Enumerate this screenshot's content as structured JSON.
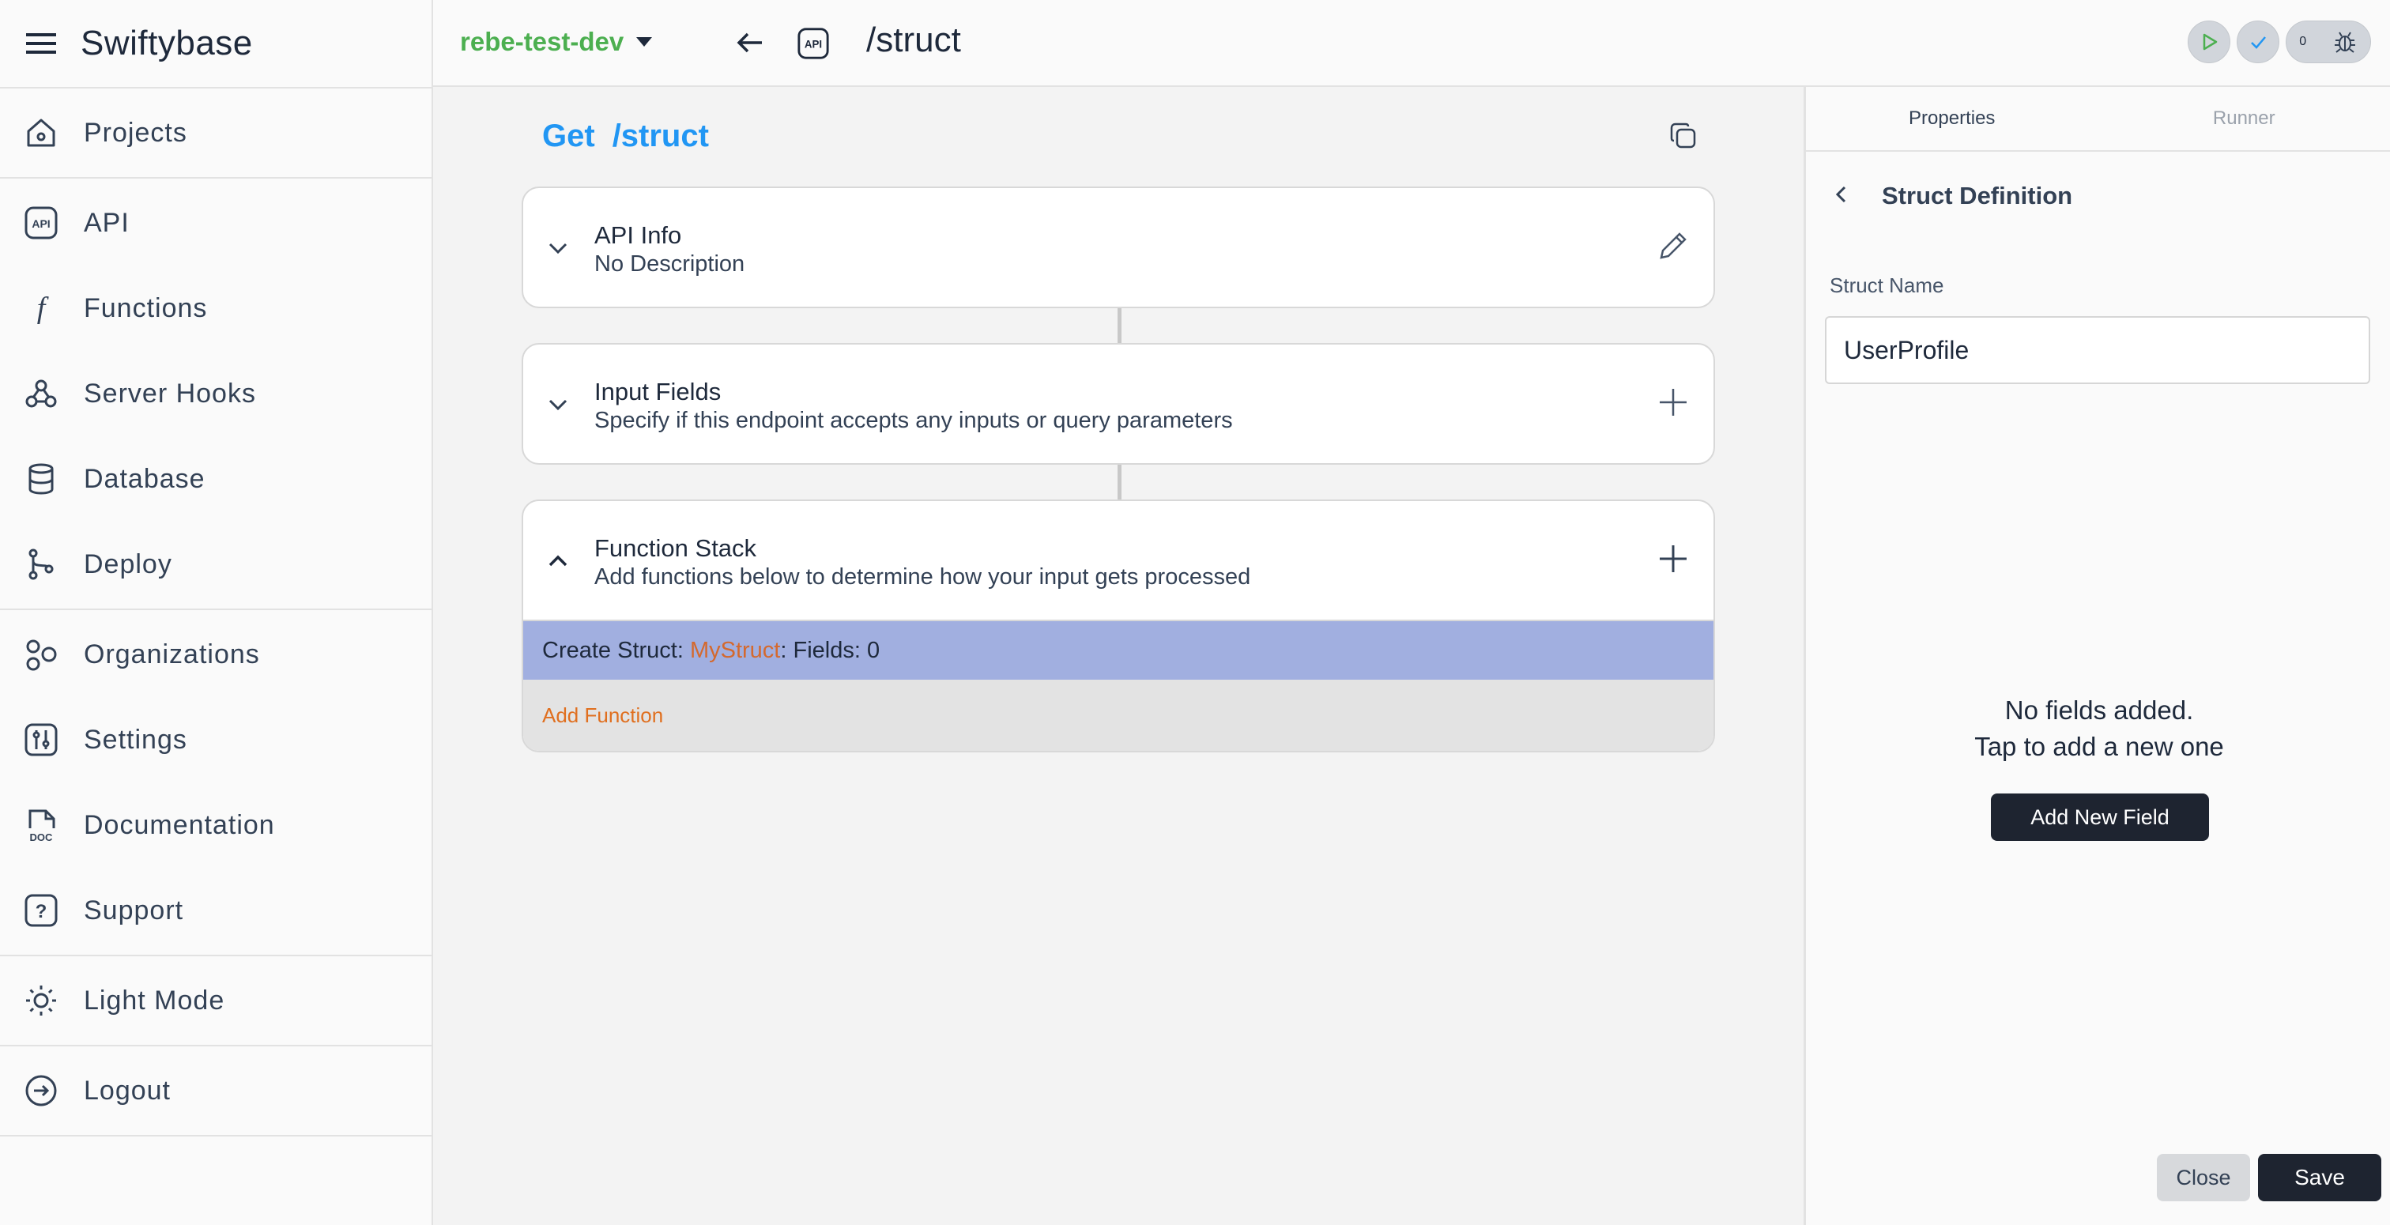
{
  "app": {
    "title": "Swiftybase"
  },
  "sidebar": {
    "groups": [
      [
        {
          "label": "Projects",
          "icon": "home-icon"
        }
      ],
      [
        {
          "label": "API",
          "icon": "api-icon"
        },
        {
          "label": "Functions",
          "icon": "function-icon"
        },
        {
          "label": "Server Hooks",
          "icon": "webhook-icon"
        },
        {
          "label": "Database",
          "icon": "database-icon"
        },
        {
          "label": "Deploy",
          "icon": "git-branch-icon"
        }
      ],
      [
        {
          "label": "Organizations",
          "icon": "organizations-icon"
        },
        {
          "label": "Settings",
          "icon": "settings-icon"
        },
        {
          "label": "Documentation",
          "icon": "doc-icon"
        },
        {
          "label": "Support",
          "icon": "help-icon"
        }
      ],
      [
        {
          "label": "Light Mode",
          "icon": "sun-icon"
        }
      ],
      [
        {
          "label": "Logout",
          "icon": "logout-icon"
        }
      ]
    ]
  },
  "topbar": {
    "project": "rebe-test-dev",
    "path": "/struct",
    "issues_count": "0"
  },
  "endpoint": {
    "method": "Get",
    "path": "/struct"
  },
  "cards": {
    "api_info": {
      "title": "API Info",
      "subtitle": "No Description"
    },
    "input_fields": {
      "title": "Input Fields",
      "subtitle": "Specify if this endpoint accepts any inputs or query parameters"
    },
    "function_stack": {
      "title": "Function Stack",
      "subtitle": "Add functions below to determine how your input gets processed",
      "item": {
        "prefix": "Create Struct: ",
        "name": "MyStruct",
        "suffix": ": Fields: 0"
      },
      "add_label": "Add Function"
    }
  },
  "panel": {
    "tabs": [
      "Properties",
      "Runner"
    ],
    "title": "Struct Definition",
    "field_label": "Struct Name",
    "struct_name": "UserProfile",
    "empty_line1": "No fields added.",
    "empty_line2": "Tap to add a new one",
    "add_field": "Add New Field",
    "close": "Close",
    "save": "Save"
  },
  "colors": {
    "accent_blue": "#2196f3",
    "project_green": "#4caf50",
    "struct_row": "#a1afe0",
    "orange": "#e06f1f"
  }
}
